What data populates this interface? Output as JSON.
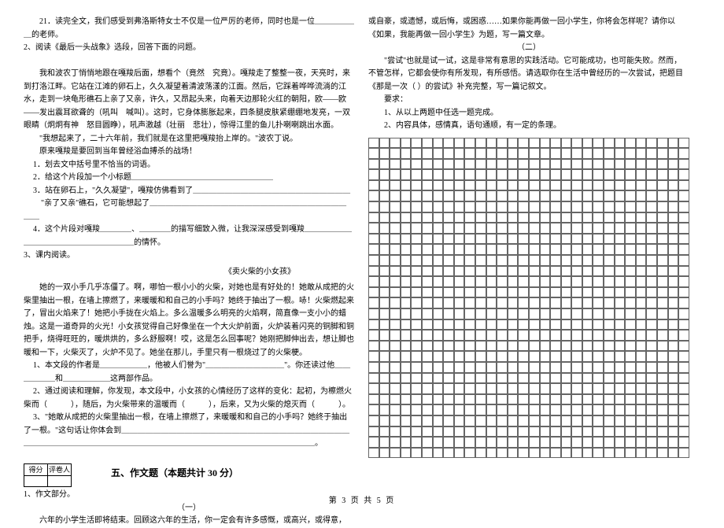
{
  "left": {
    "q21": "21．读完全文，我们感受到弗洛斯特女士不仅是一位严厉的老师，同时也是一位＿＿＿＿＿＿的老师。",
    "q2": "2、阅读《最后一头战象》选段，回答下面的问题。",
    "p1": "我和波农丁悄悄地跟在嘎羧后面，想看个（竟然　究竟）。嘎羧走了整整一夜，天亮时，来到打洛江畔。它站在江滩的卵石上，久久凝望着清波荡漾的江面。然后，它踩着哗哗流淌的江水，走到一块龟形礁石上亲了又亲，许久，又昂起头来，向着天边那轮火红的朝阳，欧——欧——发出震耳欲聋的（吼叫　喊叫）。这时，它身体膨胀起来，四条腿皮肤紧绷绷地发亮，一双眼睛（炯炯有神　怒目圆睁），吼声激越（壮丽　悲壮），惊得江里的鱼儿扑喇喇跳出水面。",
    "p2": "\"我想起来了，二十六年前，我们就是在这里把嘎羧抬上岸的。\"波农丁说。",
    "p3": "原来嘎羧是要回到当年曾经浴血搏杀的战场！",
    "s1": "1．划去文中括号里不恰当的词语。",
    "s2": "2．给这个片段加一个小标题＿＿＿＿＿＿＿＿＿＿＿＿＿＿＿＿＿＿",
    "s3": "3．站在卵石上，\"久久凝望\"，嘎羧仿佛看到了＿＿＿＿＿＿＿＿＿＿＿＿＿＿＿＿＿＿＿＿",
    "s3b": "\"亲了又亲\"礁石，它可能想起了＿＿＿＿＿＿＿＿＿＿＿＿＿＿＿＿＿＿＿＿＿＿＿＿＿＿＿",
    "s4": "4．这个片段对嘎羧＿＿＿＿、＿＿＿＿的描写细致入微，让我深深感受到嘎羧＿＿＿＿＿＿＿＿＿＿＿＿＿＿＿＿＿＿＿＿的情怀。",
    "q3": "3、课内阅读。",
    "storytitle": "《卖火柴的小女孩》",
    "sp1": "她的一双小手几乎冻僵了。啊，哪怕一根小小的火柴，对她也是有好处的！她敢从成把的火柴里抽出一根，在墙上擦燃了，来暖暖和和自己的小手吗？她终于抽出了一根。哧！火柴燃起来了，冒出火焰来了！她把小手拢在火焰上。多么温暖多么明亮的火焰啊，简直像一支小小的蜡烛。这是一道奇异的火光！小女孩觉得自己好像坐在一个大火炉前面，火炉装着闪亮的铜脚和铜把手，烧得旺旺的，暖烘烘的，多么舒服啊！哎，这是怎么回事呢？她刚把脚伸出去，想让脚也暖和一下，火柴灭了，火炉不见了。她坐在那儿，手里只有一根烧过了的火柴梗。",
    "ss1": "1、本文段的作者是＿＿＿＿＿＿，他被人们誉为\"＿＿＿＿＿＿＿＿＿＿\"。你还读过他＿＿＿＿＿＿和＿＿＿＿＿＿这两部作品。",
    "ss2": "2、通过阅读和理解，你发现，本文段中，小女孩的心情经历了这样的变化：起初，为檫燃火柴而（　　　），随后，为火柴带来的温暖而（　　　），后来，又为火柴的熄灭而（　　　）。",
    "ss3": "3、\"她敢从成把的火柴里抽出一根，在墙上擦燃了，来暖暖和和自己的小手吗？她终于抽出了一根。\"这句话让你体会到＿＿＿＿＿＿＿＿＿＿＿＿＿＿＿＿＿＿＿＿＿＿＿＿＿＿＿＿＿＿＿＿＿＿＿＿＿＿＿＿＿＿＿＿＿＿＿＿＿＿＿＿＿＿＿＿＿＿＿＿＿＿＿＿＿＿。",
    "score_h1": "得分",
    "score_h2": "评卷人",
    "sect5": "五、作文题（本题共计 30 分）",
    "w1": "1、作文部分。",
    "wyi": "（一）",
    "wp1": "六年的小学生活即将结束。回顾这六年的生活，你一定会有许多感慨，或高兴，或得意，"
  },
  "right": {
    "rp1": "或自豪，或遗憾，或后悔，或困惑……如果你能再做一回小学生，你将会怎样呢？请你以《如果，我能再做一回小学生》为题，写一篇文章。",
    "wer": "（二）",
    "rp2": "\"尝试\"也就是试一试，这是非常有意思的实践活动。它可能成功，也可能失败。然而，不管怎样，它都会使你有所发现，有所感悟。请选取你在生活中曾经历的一次尝试，把题目《那是一次（ ）的尝试》补充完整，写一篇记叙文。",
    "req": "要求：",
    "r1": "1、从以上两题中任选一题完成。",
    "r2": "2、内容具体，感情真，语句通顺，有一定的条理。"
  },
  "footer": "第 3 页 共 5 页",
  "grid": {
    "rows": 30,
    "cols": 30
  }
}
